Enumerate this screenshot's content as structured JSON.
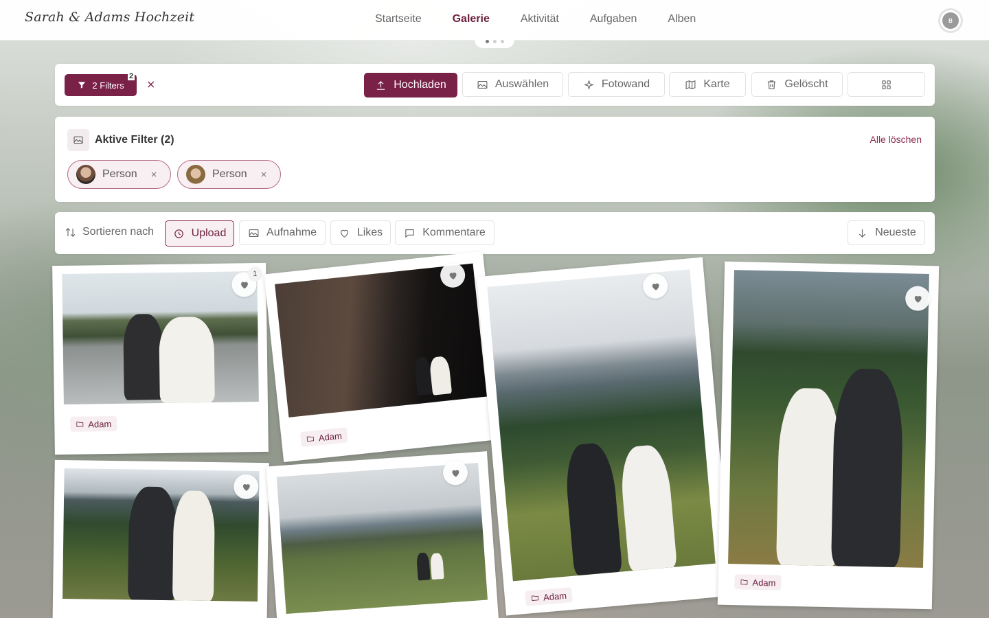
{
  "brand": "Sarah & Adams Hochzeit",
  "nav": [
    "Startseite",
    "Galerie",
    "Aktivität",
    "Aufgaben",
    "Alben"
  ],
  "nav_active": "Galerie",
  "user_initial": "B",
  "toolbar": {
    "filters_label": "2 Filters",
    "filters_count": "2",
    "clear_symbol": "×",
    "upload": "Hochladen",
    "select": "Auswählen",
    "photowall": "Fotowand",
    "map": "Karte",
    "deleted": "Gelöscht"
  },
  "active_filters": {
    "title": "Aktive Filter (2)",
    "clear_all": "Alle löschen",
    "chips": [
      {
        "label": "Person",
        "remove": "×"
      },
      {
        "label": "Person",
        "remove": "×"
      }
    ]
  },
  "sort": {
    "label": "Sortieren nach",
    "options": [
      "Upload",
      "Aufnahme",
      "Likes",
      "Kommentare"
    ],
    "selected": "Upload",
    "order": "Neueste"
  },
  "photos": [
    {
      "album": "Adam",
      "likes": "1"
    },
    {
      "album": "Adam"
    },
    {
      "album": "Adam"
    },
    {
      "album": "Adam"
    },
    {
      "album": ""
    },
    {
      "album": ""
    }
  ],
  "colors": {
    "accent": "#7a2148",
    "accent_light": "#f8eff2",
    "text": "#666666"
  },
  "icons": [
    "filter-icon",
    "close-icon",
    "upload-icon",
    "image-icon",
    "sparkles-icon",
    "map-icon",
    "trash-icon",
    "grid-icon",
    "sort-icon",
    "clock-icon",
    "heart-icon",
    "comment-icon",
    "arrow-down-icon",
    "folder-icon"
  ]
}
